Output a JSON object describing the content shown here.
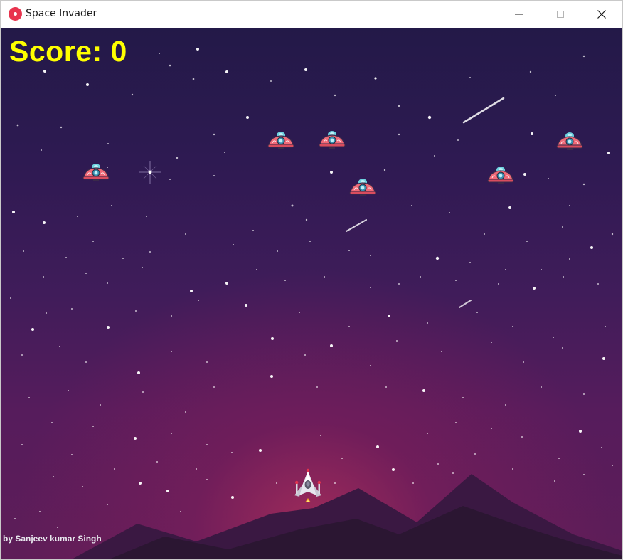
{
  "window": {
    "title": "Space Invader",
    "icon": "app-icon",
    "controls": [
      "minimize-icon",
      "maximize-icon",
      "close-icon"
    ]
  },
  "game": {
    "score_text": "Score: 0",
    "score": 0,
    "credit": "by Sanjeev kumar Singh",
    "colors": {
      "score": "#ffff00",
      "sky_top": "#231948",
      "sky_bottom": "#5e1d58",
      "horizon_glow": "#aa2d5a",
      "mountain": "#3a1842",
      "mountain_front": "#2b1632",
      "enemy_body": "#f06a78",
      "enemy_dome": "#6fd3e0"
    },
    "enemies": 6,
    "player": "spaceship-icon",
    "enemy_icon": "ufo-icon"
  }
}
